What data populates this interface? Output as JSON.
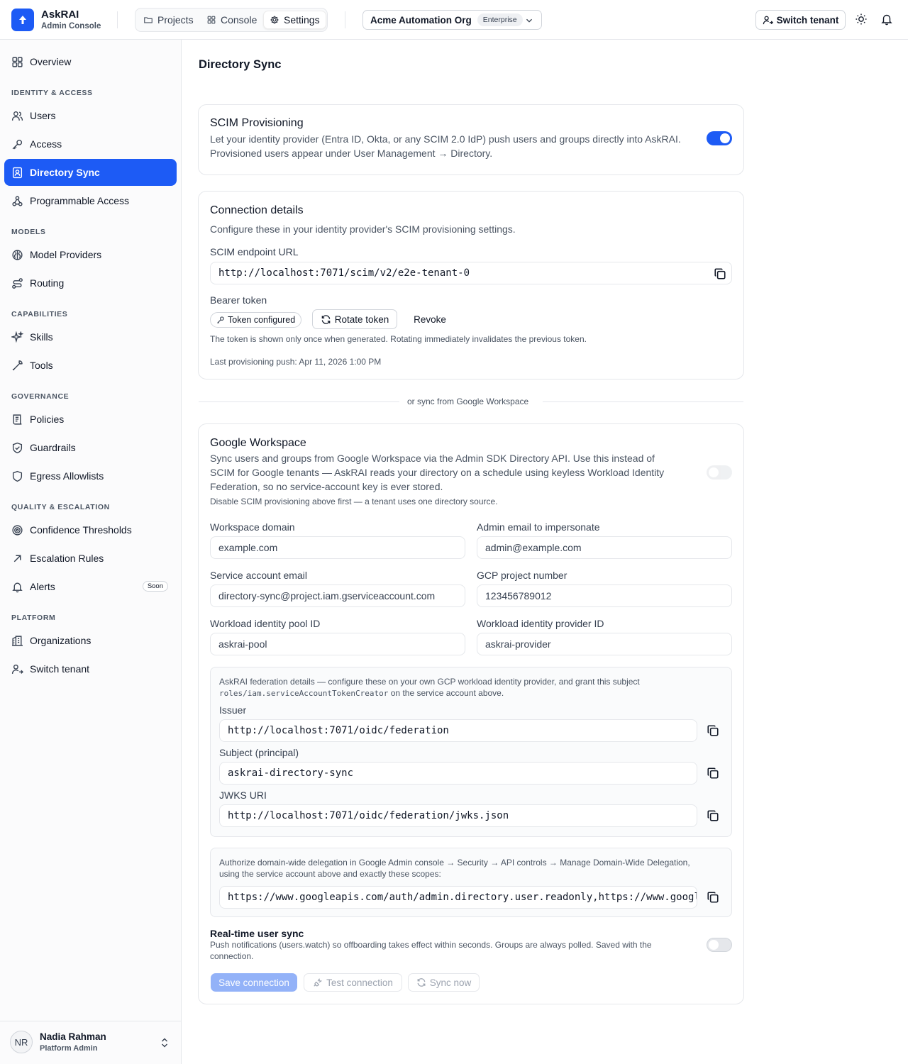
{
  "app": {
    "name": "AskRAI",
    "subtitle": "Admin Console"
  },
  "topnav": {
    "items": [
      {
        "label": "Projects",
        "icon": "folder-icon"
      },
      {
        "label": "Console",
        "icon": "grid-icon"
      },
      {
        "label": "Settings",
        "icon": "gear-icon",
        "active": true
      }
    ],
    "org": {
      "name": "Acme Automation Org",
      "badge": "Enterprise"
    },
    "switch_tenant": "Switch tenant"
  },
  "sidebar": {
    "overview": "Overview",
    "sections": [
      {
        "heading": "IDENTITY & ACCESS",
        "items": [
          "Users",
          "Access",
          "Directory Sync",
          "Programmable Access"
        ]
      },
      {
        "heading": "MODELS",
        "items": [
          "Model Providers",
          "Routing"
        ]
      },
      {
        "heading": "CAPABILITIES",
        "items": [
          "Skills",
          "Tools"
        ]
      },
      {
        "heading": "GOVERNANCE",
        "items": [
          "Policies",
          "Guardrails",
          "Egress Allowlists"
        ]
      },
      {
        "heading": "QUALITY & ESCALATION",
        "items": [
          "Confidence Thresholds",
          "Escalation Rules",
          "Alerts"
        ]
      },
      {
        "heading": "PLATFORM",
        "items": [
          "Organizations",
          "Switch tenant"
        ]
      }
    ],
    "active_item": "Directory Sync",
    "soon_badge": "Soon",
    "user": {
      "initials": "NR",
      "name": "Nadia Rahman",
      "role": "Platform Admin"
    }
  },
  "page": {
    "title": "Directory Sync"
  },
  "scim": {
    "title": "SCIM Provisioning",
    "description_1": "Let your identity provider (Entra ID, Okta, or any SCIM 2.0 IdP) push users and groups directly into AskRAI.",
    "description_2": "Provisioned users appear under User Management → Directory.",
    "enabled": true
  },
  "connection": {
    "title": "Connection details",
    "description": "Configure these in your identity provider's SCIM provisioning settings.",
    "endpoint_label": "SCIM endpoint URL",
    "endpoint_value": "http://localhost:7071/scim/v2/e2e-tenant-0",
    "token_label": "Bearer token",
    "token_status": "Token configured",
    "rotate_label": "Rotate token",
    "revoke_label": "Revoke",
    "token_note": "The token is shown only once when generated. Rotating immediately invalidates the previous token.",
    "last_push": "Last provisioning push: Apr 11, 2026 1:00 PM"
  },
  "divider": "or sync from Google Workspace",
  "google": {
    "title": "Google Workspace",
    "description_1": "Sync users and groups from Google Workspace via the Admin SDK Directory API. Use this instead of",
    "description_2": "SCIM for Google tenants — AskRAI reads your directory on a schedule using keyless Workload Identity",
    "description_3": "Federation, so no service-account key is ever stored.",
    "disable_note": "Disable SCIM provisioning above first — a tenant uses one directory source.",
    "enabled": false,
    "fields": {
      "domain_label": "Workspace domain",
      "domain_placeholder": "example.com",
      "admin_label": "Admin email to impersonate",
      "admin_placeholder": "admin@example.com",
      "sa_label": "Service account email",
      "sa_placeholder": "directory-sync@project.iam.gserviceaccount.com",
      "gcp_label": "GCP project number",
      "gcp_placeholder": "123456789012",
      "pool_label": "Workload identity pool ID",
      "pool_placeholder": "askrai-pool",
      "provider_label": "Workload identity provider ID",
      "provider_placeholder": "askrai-provider"
    },
    "federation": {
      "note_1": "AskRAI federation details — configure these on your own GCP workload identity provider, and grant this subject",
      "note_role": "roles/iam.serviceAccountTokenCreator",
      "note_2": " on the service account above.",
      "issuer_label": "Issuer",
      "issuer_value": "http://localhost:7071/oidc/federation",
      "subject_label": "Subject (principal)",
      "subject_value": "askrai-directory-sync",
      "jwks_label": "JWKS URI",
      "jwks_value": "http://localhost:7071/oidc/federation/jwks.json"
    },
    "delegation": {
      "note_1": "Authorize domain-wide delegation in Google Admin console → Security → API controls → Manage Domain-Wide Delegation,",
      "note_2": "using the service account above and exactly these scopes:",
      "scopes": "https://www.googleapis.com/auth/admin.directory.user.readonly,https://www.googleapis.com/auth/admin.directory.group.readonly"
    },
    "realtime": {
      "title": "Real-time user sync",
      "desc_1": "Push notifications (users.watch) so offboarding takes effect within seconds. Groups are always polled. Saved with the",
      "desc_2": "connection.",
      "enabled": false
    },
    "buttons": {
      "save": "Save connection",
      "test": "Test connection",
      "sync": "Sync now"
    }
  },
  "colors": {
    "accent": "#1d5bf5",
    "accent_disabled": "#93b2f8"
  }
}
